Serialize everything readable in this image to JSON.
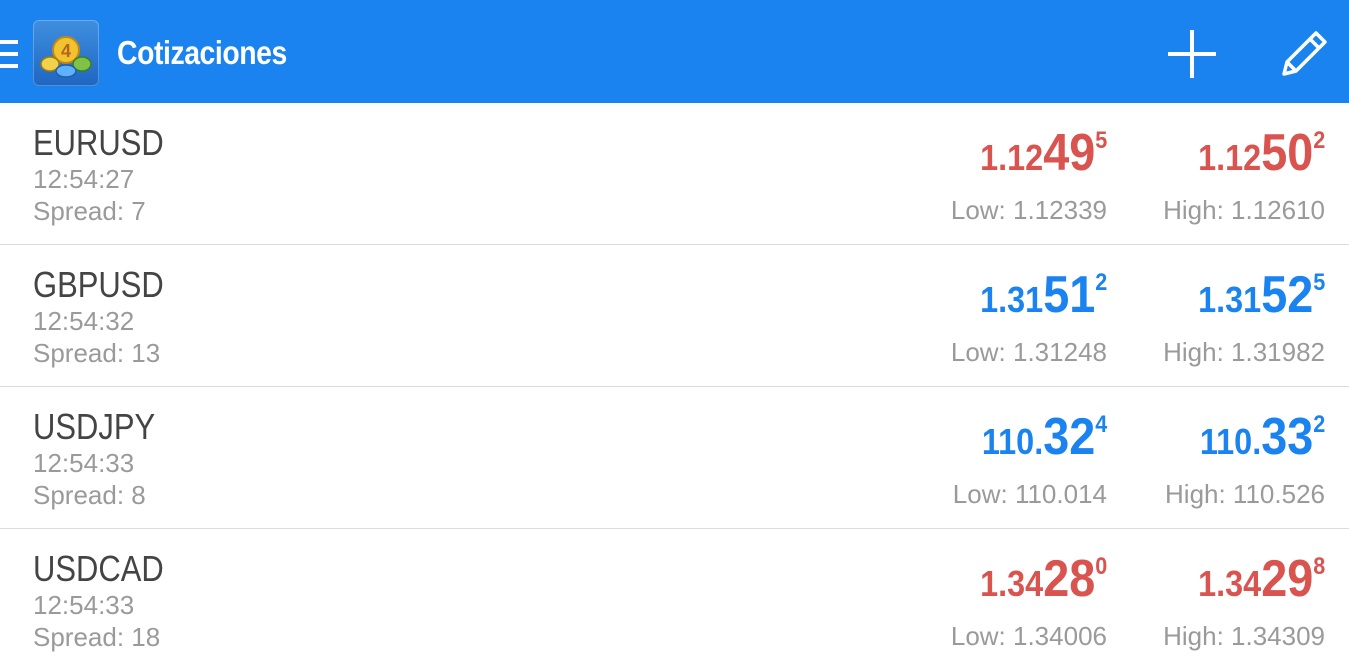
{
  "appbar": {
    "title": "Cotizaciones",
    "background": "#1a83f0",
    "icons": [
      "menu-icon",
      "metatrader-app-icon",
      "add-icon",
      "edit-pencil-icon"
    ]
  },
  "colors": {
    "down": "#d9534f",
    "up": "#1a83f0",
    "symbol_text": "#444444",
    "secondary_text": "#9a9a9a"
  },
  "quotes": [
    {
      "symbol": "EURUSD",
      "time": "12:54:27",
      "spread": "Spread: 7",
      "direction": "down",
      "bid": {
        "main": "1.12",
        "big": "49",
        "sup": "5"
      },
      "ask": {
        "main": "1.12",
        "big": "50",
        "sup": "2"
      },
      "low": "Low: 1.12339",
      "high": "High: 1.12610"
    },
    {
      "symbol": "GBPUSD",
      "time": "12:54:32",
      "spread": "Spread: 13",
      "direction": "up",
      "bid": {
        "main": "1.31",
        "big": "51",
        "sup": "2"
      },
      "ask": {
        "main": "1.31",
        "big": "52",
        "sup": "5"
      },
      "low": "Low: 1.31248",
      "high": "High: 1.31982"
    },
    {
      "symbol": "USDJPY",
      "time": "12:54:33",
      "spread": "Spread: 8",
      "direction": "up",
      "bid": {
        "main": "110.",
        "big": "32",
        "sup": "4"
      },
      "ask": {
        "main": "110.",
        "big": "33",
        "sup": "2"
      },
      "low": "Low: 110.014",
      "high": "High: 110.526"
    },
    {
      "symbol": "USDCAD",
      "time": "12:54:33",
      "spread": "Spread: 18",
      "direction": "down",
      "bid": {
        "main": "1.34",
        "big": "28",
        "sup": "0"
      },
      "ask": {
        "main": "1.34",
        "big": "29",
        "sup": "8"
      },
      "low": "Low: 1.34006",
      "high": "High: 1.34309"
    }
  ]
}
